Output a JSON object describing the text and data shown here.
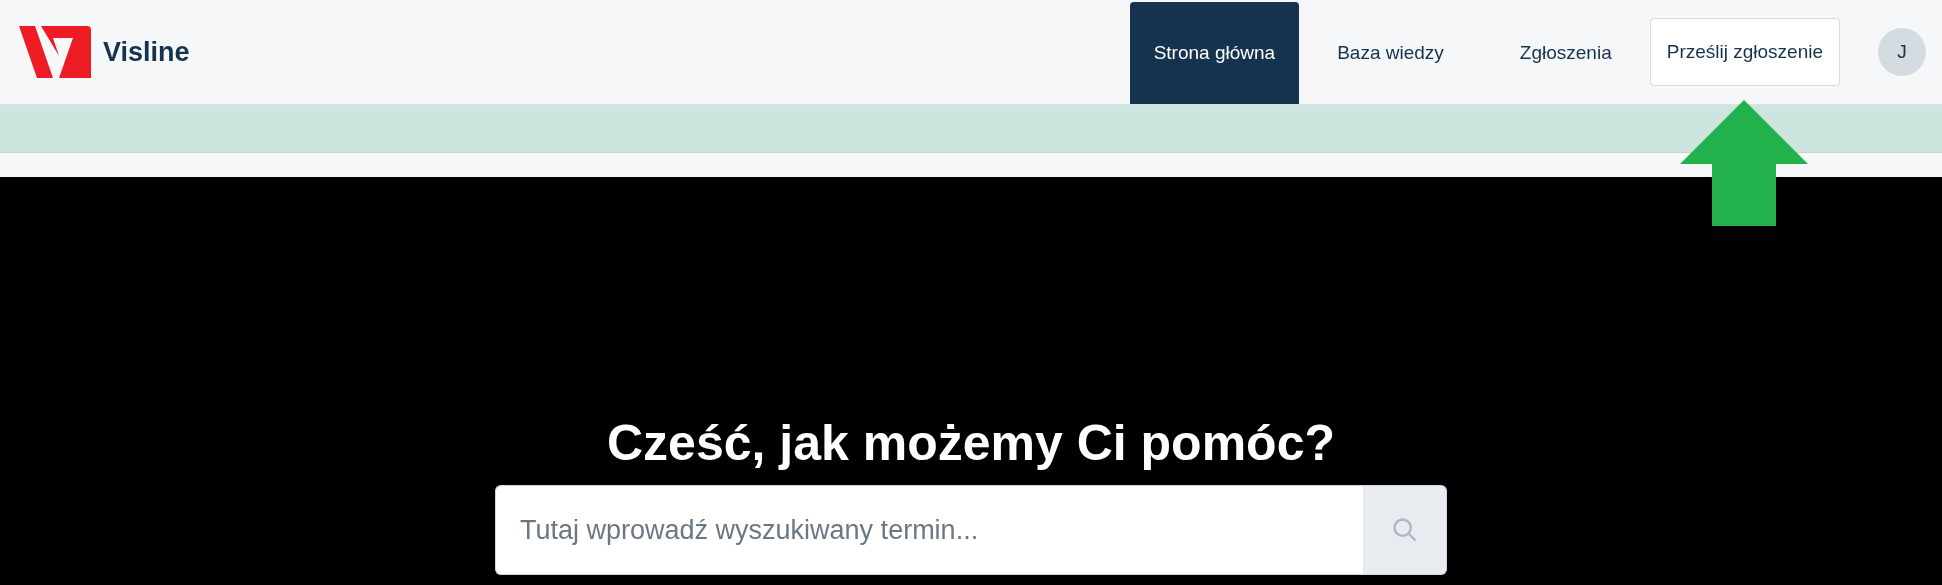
{
  "brand": {
    "name": "Visline"
  },
  "nav": [
    {
      "label": "Strona główna",
      "selected": true
    },
    {
      "label": "Baza wiedzy",
      "selected": false
    },
    {
      "label": "Zgłoszenia",
      "selected": false
    }
  ],
  "submit_button": {
    "label": "Prześlij zgłoszenie"
  },
  "avatar": {
    "initial": "J"
  },
  "hero": {
    "title": "Cześć, jak możemy Ci pomóc?",
    "search": {
      "placeholder": "Tutaj wprowadź wyszukiwany termin..."
    }
  }
}
